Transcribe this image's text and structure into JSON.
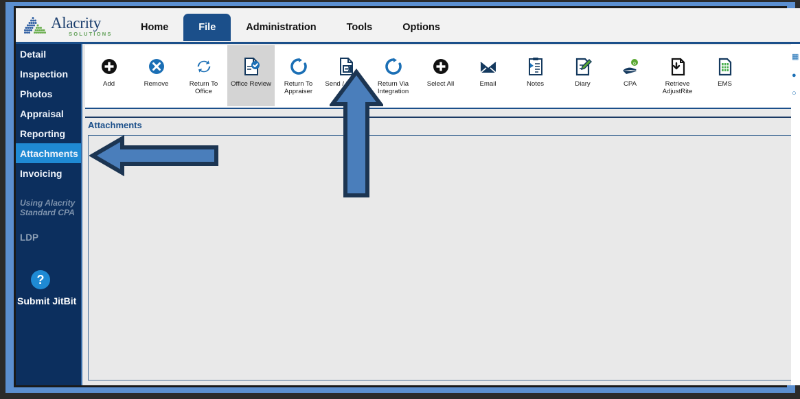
{
  "app": {
    "brand_name": "Alacrity",
    "brand_sub": "SOLUTIONS"
  },
  "colors": {
    "nav_active": "#1b4f8a",
    "sidebar_bg": "#0c2f5e",
    "sidebar_active": "#1f8ad4",
    "accent_blue": "#1b6fb5",
    "annotation_fill": "#4a7ebb",
    "annotation_stroke": "#1c3552",
    "logo_blue": "#1c3f6e",
    "logo_green": "#5e9e54",
    "panel_bg": "#e9e9e9"
  },
  "navbar": {
    "tabs": [
      {
        "label": "Home",
        "active": false
      },
      {
        "label": "File",
        "active": true
      },
      {
        "label": "Administration",
        "active": false
      },
      {
        "label": "Tools",
        "active": false
      },
      {
        "label": "Options",
        "active": false
      }
    ]
  },
  "sidebar": {
    "items": [
      {
        "label": "Detail",
        "active": false
      },
      {
        "label": "Inspection",
        "active": false
      },
      {
        "label": "Photos",
        "active": false
      },
      {
        "label": "Appraisal",
        "active": false
      },
      {
        "label": "Reporting",
        "active": false
      },
      {
        "label": "Attachments",
        "active": true
      },
      {
        "label": "Invoicing",
        "active": false
      }
    ],
    "note_line1": "Using Alacrity",
    "note_line2": "Standard CPA",
    "ldp_label": "LDP",
    "help_glyph": "?",
    "help_icon_name": "help-question-icon",
    "submit_label": "Submit JitBit"
  },
  "ribbon": {
    "buttons": [
      {
        "label": "Add",
        "icon": "plus-circle-icon",
        "selected": false
      },
      {
        "label": "Remove",
        "icon": "x-circle-icon",
        "selected": false
      },
      {
        "label": "Return To\nOffice",
        "line1": "Return To",
        "line2": "Office",
        "icon": "refresh-arrows-icon",
        "selected": false
      },
      {
        "label": "Office Review",
        "line1": "Office Review",
        "line2": "",
        "icon": "document-check-icon",
        "selected": true
      },
      {
        "label": "Return To Appraiser",
        "line1": "Return To",
        "line2": "Appraiser",
        "icon": "circular-arrow-icon",
        "selected": false
      },
      {
        "label": "Send / Extract",
        "line1": "Send / Extract",
        "line2": "",
        "icon": "document-export-icon",
        "selected": false
      },
      {
        "label": "Return Via Integration",
        "line1": "Return Via",
        "line2": "Integration",
        "icon": "circular-arrow-icon",
        "selected": false
      },
      {
        "label": "Select All",
        "line1": "Select All",
        "line2": "",
        "icon": "plus-circle-icon",
        "selected": false
      },
      {
        "label": "Email",
        "line1": "Email",
        "line2": "",
        "icon": "envelope-icon",
        "selected": false
      },
      {
        "label": "Notes",
        "line1": "Notes",
        "line2": "",
        "icon": "clipboard-pen-icon",
        "selected": false
      },
      {
        "label": "Diary",
        "line1": "Diary",
        "line2": "",
        "icon": "document-pencil-icon",
        "selected": false
      },
      {
        "label": "CPA",
        "line1": "CPA",
        "line2": "",
        "icon": "hand-coin-icon",
        "selected": false
      },
      {
        "label": "Retrieve AdjustRite",
        "line1": "Retrieve",
        "line2": "AdjustRite",
        "icon": "document-download-icon",
        "selected": false
      },
      {
        "label": "EMS",
        "line1": "EMS",
        "line2": "",
        "icon": "spreadsheet-icon",
        "selected": false
      }
    ]
  },
  "content": {
    "panel_title": "Attachments",
    "panel_body_text": ""
  },
  "annotations": [
    {
      "name": "left-pointer-arrow",
      "direction": "left",
      "target": "sidebar-item-attachments"
    },
    {
      "name": "up-pointer-arrow",
      "direction": "up",
      "target": "ribbon-button-send-extract"
    }
  ]
}
